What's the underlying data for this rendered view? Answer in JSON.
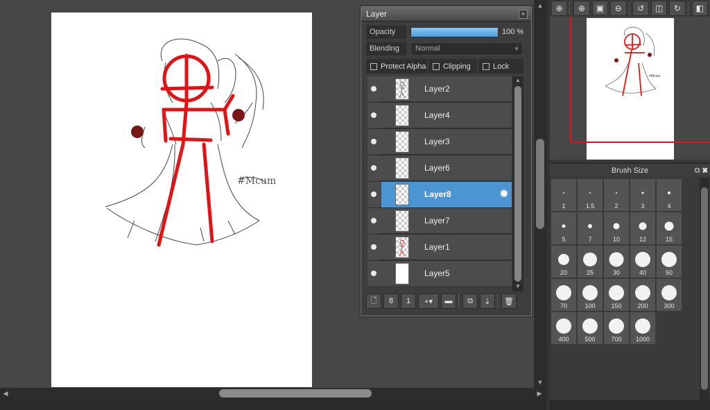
{
  "layer_panel": {
    "title": "Layer",
    "close_glyph": "×",
    "opacity_label": "Opacity",
    "opacity_value": "100 %",
    "opacity_fraction": 1.0,
    "blending_label": "Blending",
    "blending_value": "Normal",
    "checkboxes": {
      "protect_alpha": "Protect Alpha",
      "clipping": "Clipping",
      "lock": "Lock"
    },
    "layers": [
      {
        "name": "Layer2",
        "thumb": "sketch"
      },
      {
        "name": "Layer4",
        "thumb": "transparent"
      },
      {
        "name": "Layer3",
        "thumb": "transparent"
      },
      {
        "name": "Layer6",
        "thumb": "transparent"
      },
      {
        "name": "Layer8",
        "thumb": "transparent",
        "selected": true
      },
      {
        "name": "Layer7",
        "thumb": "transparent"
      },
      {
        "name": "Layer1",
        "thumb": "red-sketch"
      },
      {
        "name": "Layer5",
        "thumb": "white"
      }
    ],
    "toolbar_icons": [
      "new-layer-icon",
      "new-8bit-layer-icon",
      "new-1bit-layer-icon",
      "add-layer-menu-icon",
      "folder-icon",
      "duplicate-icon",
      "merge-icon",
      "delete-icon"
    ]
  },
  "navigator": {
    "toolbar_icons": [
      "fit-window-icon",
      "zoom-in-icon",
      "actual-size-icon",
      "zoom-out-icon",
      "rotate-left-icon",
      "reset-rotation-icon",
      "rotate-right-icon",
      "flip-horizontal-icon"
    ]
  },
  "brush_size": {
    "title": "Brush Size",
    "sizes": [
      "1",
      "1.5",
      "2",
      "3",
      "4",
      "5",
      "7",
      "10",
      "12",
      "15",
      "20",
      "25",
      "30",
      "40",
      "50",
      "70",
      "100",
      "150",
      "200",
      "300",
      "400",
      "500",
      "700",
      "1000"
    ]
  },
  "colors": {
    "accent_blue": "#4a95d2",
    "sketch_red": "#e01414"
  }
}
